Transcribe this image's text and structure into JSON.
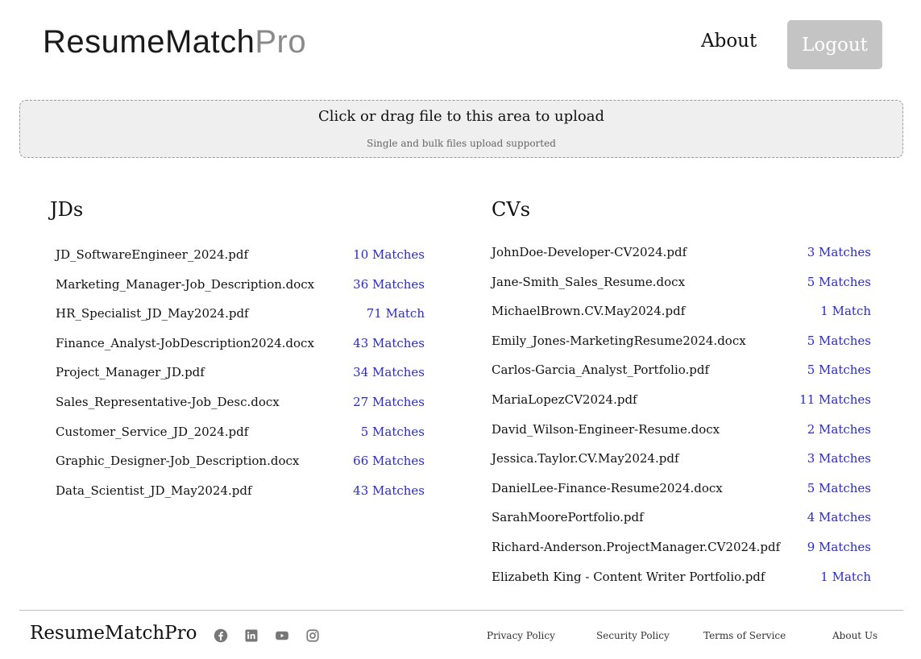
{
  "header": {
    "logo_main": "ResumeMatch",
    "logo_pro": "Pro",
    "about_label": "About",
    "logout_label": "Logout"
  },
  "upload": {
    "title": "Click or drag file to this area to upload",
    "subtitle": "Single and bulk files upload supported"
  },
  "jds": {
    "title": "JDs",
    "items": [
      {
        "name": "JD_SoftwareEngineer_2024.pdf",
        "matches": "10 Matches"
      },
      {
        "name": "Marketing_Manager-Job_Description.docx",
        "matches": "36 Matches"
      },
      {
        "name": "HR_Specialist_JD_May2024.pdf",
        "matches": "71 Match"
      },
      {
        "name": "Finance_Analyst-JobDescription2024.docx",
        "matches": "43 Matches"
      },
      {
        "name": "Project_Manager_JD.pdf",
        "matches": "34 Matches"
      },
      {
        "name": "Sales_Representative-Job_Desc.docx",
        "matches": "27 Matches"
      },
      {
        "name": "Customer_Service_JD_2024.pdf",
        "matches": "5 Matches"
      },
      {
        "name": "Graphic_Designer-Job_Description.docx",
        "matches": "66 Matches"
      },
      {
        "name": "Data_Scientist_JD_May2024.pdf",
        "matches": "43 Matches"
      }
    ]
  },
  "cvs": {
    "title": "CVs",
    "items": [
      {
        "name": "JohnDoe-Developer-CV2024.pdf",
        "matches": "3 Matches"
      },
      {
        "name": "Jane-Smith_Sales_Resume.docx",
        "matches": "5 Matches"
      },
      {
        "name": "MichaelBrown.CV.May2024.pdf",
        "matches": "1 Match"
      },
      {
        "name": "Emily_Jones-MarketingResume2024.docx",
        "matches": "5 Matches"
      },
      {
        "name": "Carlos-Garcia_Analyst_Portfolio.pdf",
        "matches": "5 Matches"
      },
      {
        "name": "MariaLopezCV2024.pdf",
        "matches": "11 Matches"
      },
      {
        "name": "David_Wilson-Engineer-Resume.docx",
        "matches": "2 Matches"
      },
      {
        "name": "Jessica.Taylor.CV.May2024.pdf",
        "matches": "3 Matches"
      },
      {
        "name": "DanielLee-Finance-Resume2024.docx",
        "matches": "5 Matches"
      },
      {
        "name": "SarahMoorePortfolio.pdf",
        "matches": "4 Matches"
      },
      {
        "name": "Richard-Anderson.ProjectManager.CV2024.pdf",
        "matches": "9 Matches"
      },
      {
        "name": "Elizabeth King - Content Writer Portfolio.pdf",
        "matches": "1 Match"
      }
    ]
  },
  "footer": {
    "logo": "ResumeMatchPro",
    "socials": [
      "facebook-icon",
      "linkedin-icon",
      "youtube-icon",
      "instagram-icon"
    ],
    "links": [
      "Privacy Policy",
      "Security Policy",
      "Terms of Service",
      "About Us"
    ]
  },
  "colors": {
    "match_link": "#2a2acf",
    "logout_bg": "#c4c4c4",
    "upload_bg": "#efefef"
  }
}
